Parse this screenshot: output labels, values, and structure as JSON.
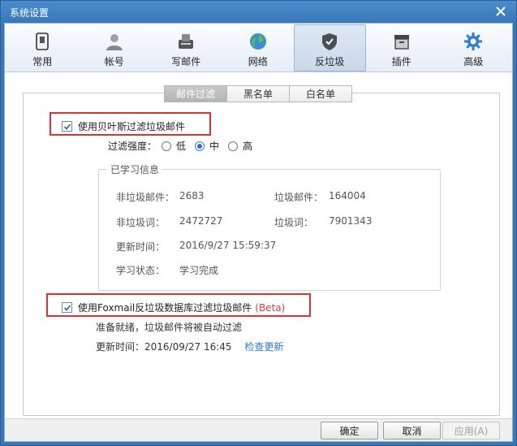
{
  "window": {
    "title": "系统设置"
  },
  "toolbar": {
    "items": [
      {
        "label": "常用",
        "icon": "device-icon"
      },
      {
        "label": "帐号",
        "icon": "user-icon"
      },
      {
        "label": "写邮件",
        "icon": "compose-icon"
      },
      {
        "label": "网络",
        "icon": "globe-icon"
      },
      {
        "label": "反垃圾",
        "icon": "shield-icon",
        "active": true
      },
      {
        "label": "插件",
        "icon": "plugin-box-icon"
      },
      {
        "label": "高级",
        "icon": "gear-icon"
      }
    ]
  },
  "tabs": [
    {
      "label": "邮件过滤",
      "active": true
    },
    {
      "label": "黑名单"
    },
    {
      "label": "白名单"
    }
  ],
  "bayes": {
    "label": "使用贝叶斯过滤垃圾邮件",
    "checked": true,
    "strength_label": "过滤强度：",
    "options": [
      {
        "label": "低",
        "checked": false
      },
      {
        "label": "中",
        "checked": true
      },
      {
        "label": "高",
        "checked": false
      }
    ]
  },
  "learned": {
    "legend": "已学习信息",
    "nonspam_mail_label": "非垃圾邮件：",
    "nonspam_mail_value": "2683",
    "spam_mail_label": "垃圾邮件：",
    "spam_mail_value": "164004",
    "nonspam_word_label": "非垃圾词：",
    "nonspam_word_value": "2472727",
    "spam_word_label": "垃圾词：",
    "spam_word_value": "7901343",
    "update_label": "更新时间：",
    "update_value": "2016/9/27 15:59:37",
    "status_label": "学习状态：",
    "status_value": "学习完成"
  },
  "foxmail_db": {
    "label": "使用Foxmail反垃圾数据库过滤垃圾邮件",
    "beta": "(Beta)",
    "checked": true,
    "ready_text": "准备就绪，垃圾邮件将被自动过滤",
    "update_text": "更新时间：2016/09/27 16:45",
    "check_update": "检查更新"
  },
  "footer": {
    "ok": "确定",
    "cancel": "取消",
    "apply": "应用(A)"
  },
  "colors": {
    "accent": "#3a7bd5",
    "highlight": "#e03030",
    "link": "#2a7ad6"
  }
}
